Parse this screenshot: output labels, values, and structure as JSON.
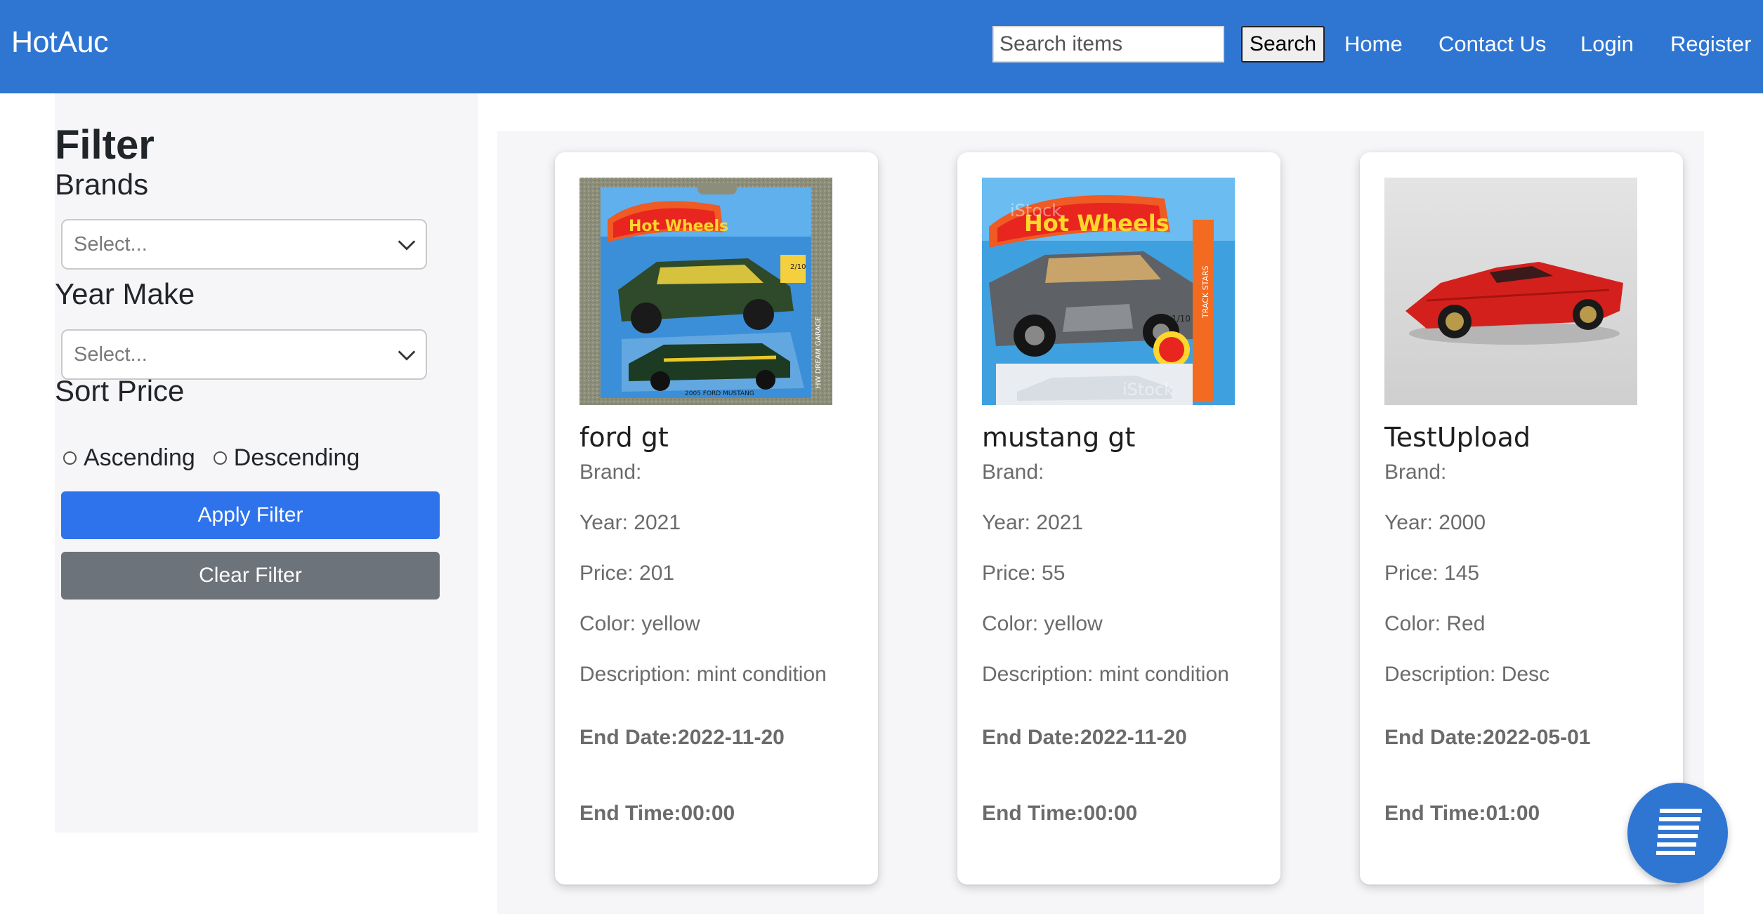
{
  "app": {
    "brand": "HotAuc"
  },
  "header": {
    "search_placeholder": "Search items",
    "search_button": "Search",
    "nav": [
      "Home",
      "Contact Us",
      "Login",
      "Register"
    ]
  },
  "sidebar": {
    "title": "Filter",
    "brands_label": "Brands",
    "brands_placeholder": "Select...",
    "year_label": "Year Make",
    "year_placeholder": "Select...",
    "sort_label": "Sort Price",
    "sort_options": [
      "Ascending",
      "Descending"
    ],
    "apply_button": "Apply Filter",
    "clear_button": "Clear Filter"
  },
  "items": [
    {
      "title": "ford gt",
      "brand": "Brand:",
      "year": "Year: 2021",
      "price": "Price: 201",
      "color": "Color: yellow",
      "description": "Description: mint condition",
      "end_date": "End Date:2022-11-20",
      "end_time": "End Time:00:00",
      "image_label": "Hot Wheels",
      "image_caption": "2005 FORD MUSTANG",
      "image_side": "HW DREAM GARAGE",
      "image_count": "2/10"
    },
    {
      "title": "mustang gt",
      "brand": "Brand:",
      "year": "Year: 2021",
      "price": "Price: 55",
      "color": "Color: yellow",
      "description": "Description: mint condition",
      "end_date": "End Date:2022-11-20",
      "end_time": "End Time:00:00",
      "image_label": "Hot Wheels",
      "image_count": "1/10",
      "image_side": "TRACK STARS",
      "image_watermark": "iStock"
    },
    {
      "title": "TestUpload",
      "brand": "Brand:",
      "year": "Year: 2000",
      "price": "Price: 145",
      "color": "Color: Red",
      "description": "Description: Desc",
      "end_date": "End Date:2022-05-01",
      "end_time": "End Time:01:00"
    }
  ],
  "icons": {
    "chevron": "chevron-down-icon",
    "fab": "document-lines-icon"
  },
  "colors": {
    "navbar": "#2f76d2",
    "apply": "#2e73eb",
    "clear": "#6c737a",
    "panel": "#f6f6f8"
  }
}
